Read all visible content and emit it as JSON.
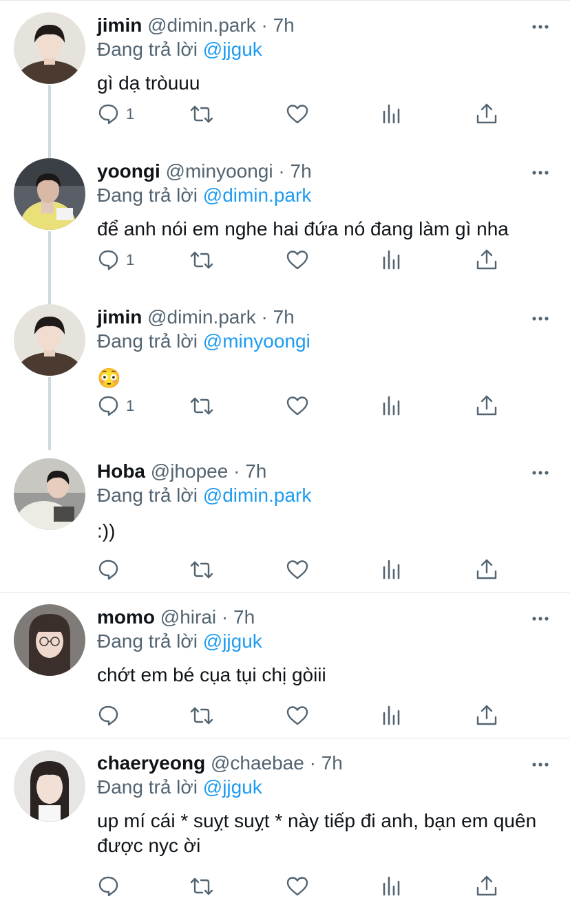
{
  "colors": {
    "accent": "#1d9bf0",
    "secondary": "#536471",
    "thread_line": "#cfd9de"
  },
  "icons": [
    "more-icon",
    "reply-icon",
    "retweet-icon",
    "like-icon",
    "stats-icon",
    "share-icon"
  ],
  "tweets": [
    {
      "name": "jimin",
      "handle": "@dimin.park",
      "dot": "·",
      "time": "7h",
      "reply_prefix": "Đang trả lời",
      "reply_to": "@jjguk",
      "text": "gì dạ tròuuu",
      "reply_count": "1"
    },
    {
      "name": "yoongi",
      "handle": "@minyoongi",
      "dot": "·",
      "time": "7h",
      "reply_prefix": "Đang trả lời",
      "reply_to": "@dimin.park",
      "text": "để anh nói em nghe hai đứa nó đang làm gì nha",
      "reply_count": "1"
    },
    {
      "name": "jimin",
      "handle": "@dimin.park",
      "dot": "·",
      "time": "7h",
      "reply_prefix": "Đang trả lời",
      "reply_to": "@minyoongi",
      "text": "😳",
      "reply_count": "1"
    },
    {
      "name": "Hoba",
      "handle": "@jhopee",
      "dot": "·",
      "time": "7h",
      "reply_prefix": "Đang trả lời",
      "reply_to": "@dimin.park",
      "text": ":))",
      "reply_count": ""
    },
    {
      "name": "momo",
      "handle": "@hirai",
      "dot": "·",
      "time": "7h",
      "reply_prefix": "Đang trả lời",
      "reply_to": "@jjguk",
      "text": "chớt em bé cụa tụi chị gòiii",
      "reply_count": ""
    },
    {
      "name": "chaeryeong",
      "handle": "@chaebae",
      "dot": "·",
      "time": "7h",
      "reply_prefix": "Đang trả lời",
      "reply_to": "@jjguk",
      "text": "up mí cái * suỵt suỵt * này tiếp đi anh, bạn em quên được nyc ời",
      "reply_count": ""
    }
  ]
}
